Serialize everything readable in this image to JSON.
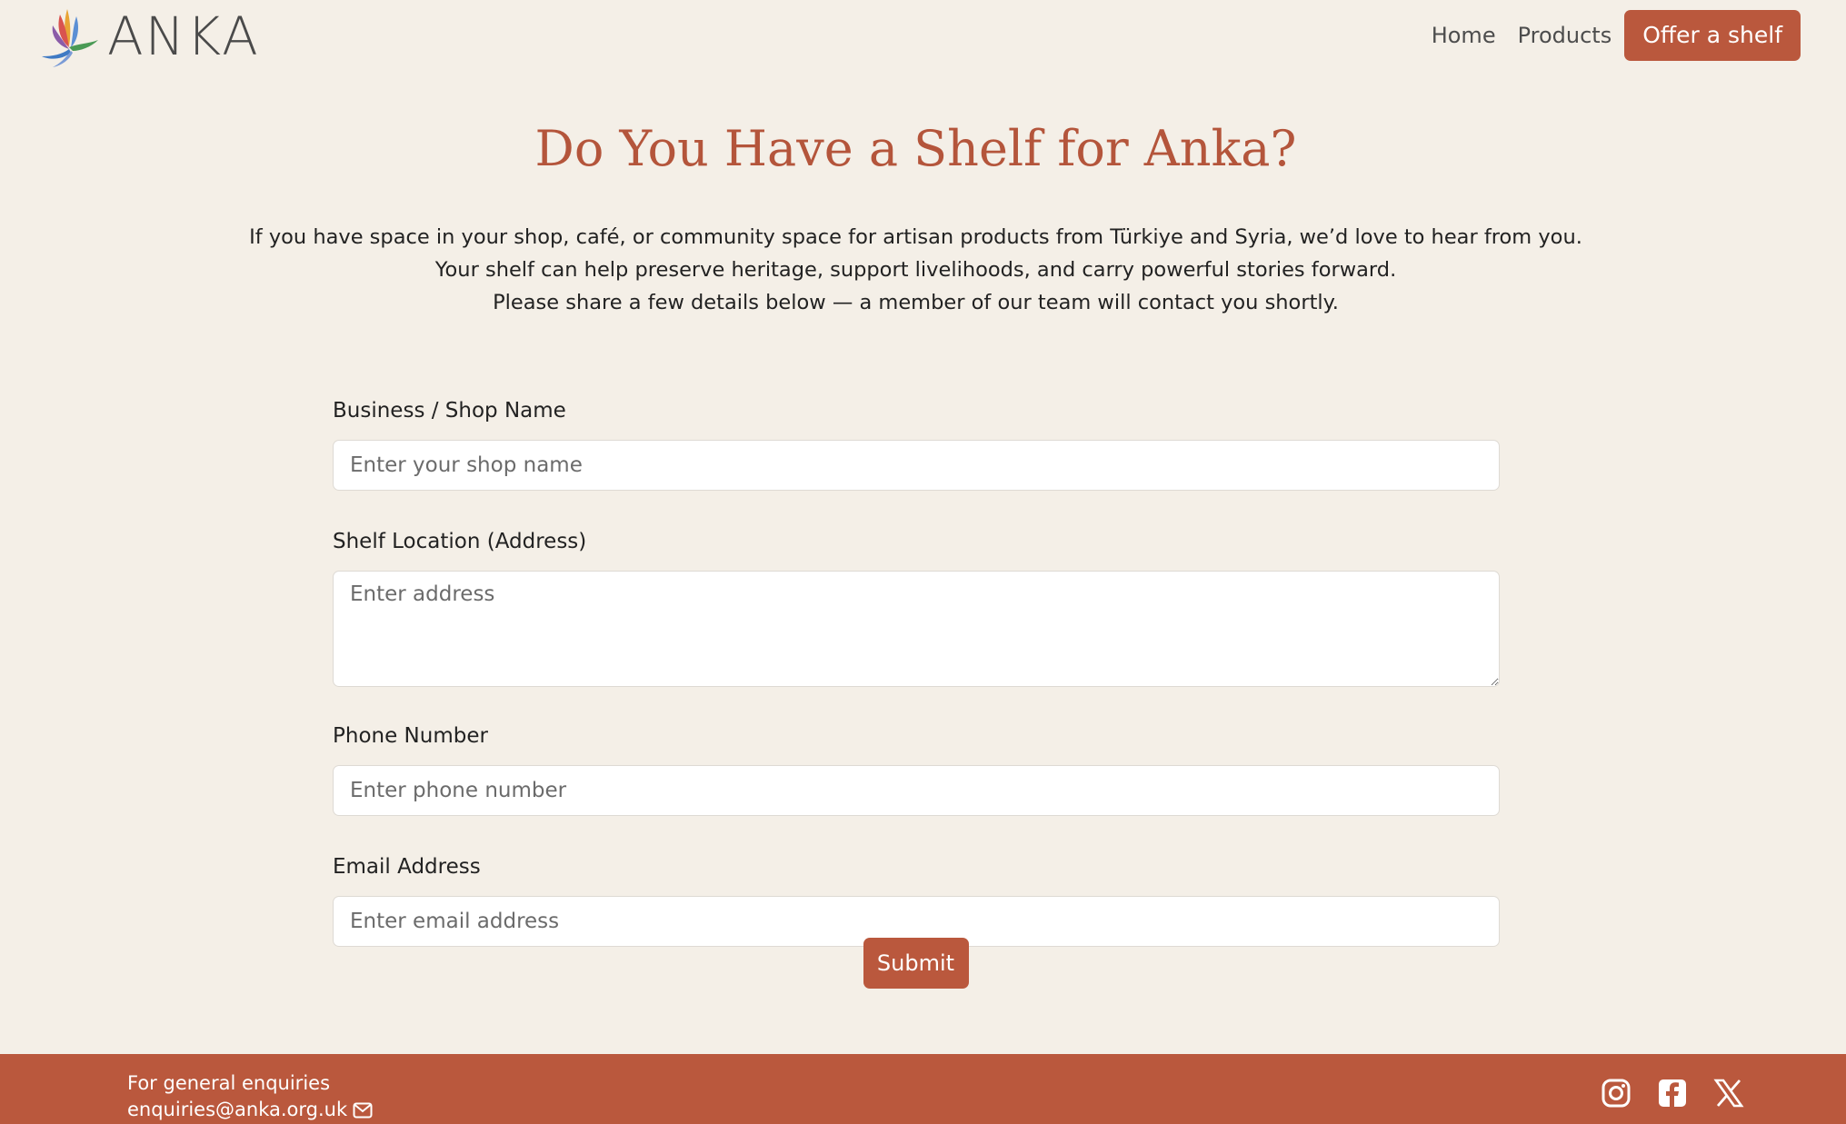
{
  "brand": {
    "name": "ANKA"
  },
  "nav": {
    "home": "Home",
    "products": "Products",
    "cta": "Offer a shelf"
  },
  "hero": {
    "title": "Do You Have a Shelf for Anka?",
    "lines": [
      "If you have space in your shop, café, or community space for artisan products from Türkiye and Syria, we’d love to hear from you.",
      "Your shelf can help preserve heritage, support livelihoods, and carry powerful stories forward.",
      "Please share a few details below — a member of our team will contact you shortly."
    ]
  },
  "form": {
    "shop_name": {
      "label": "Business / Shop Name",
      "placeholder": "Enter your shop name",
      "value": ""
    },
    "address": {
      "label": "Shelf Location (Address)",
      "placeholder": "Enter address",
      "value": ""
    },
    "phone": {
      "label": "Phone Number",
      "placeholder": "Enter phone number",
      "value": ""
    },
    "email": {
      "label": "Email Address",
      "placeholder": "Enter email address",
      "value": ""
    },
    "submit_label": "Submit"
  },
  "footer": {
    "enquiries_label": "For general enquiries",
    "email": "enquiries@anka.org.uk",
    "icons": [
      "mail-icon",
      "instagram-icon",
      "facebook-icon",
      "x-icon"
    ]
  },
  "colors": {
    "accent": "#ba583d",
    "title": "#b4553b",
    "background": "#f4efe7"
  }
}
